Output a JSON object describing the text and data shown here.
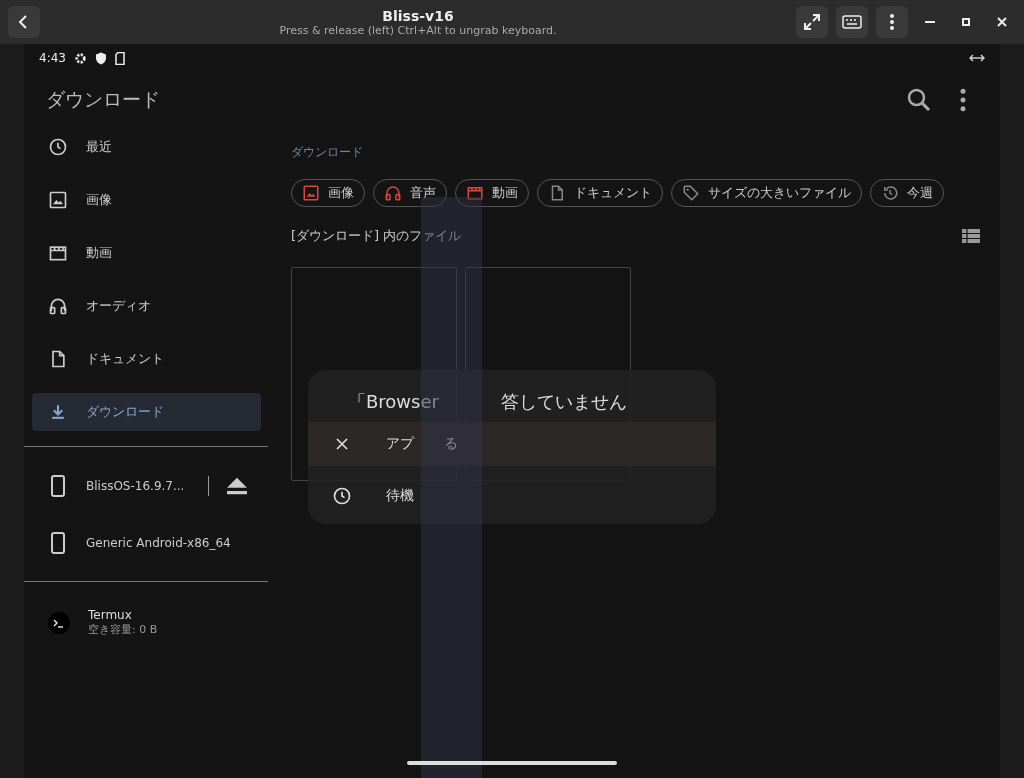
{
  "window": {
    "title": "Bliss-v16",
    "subtitle": "Press & release (left) Ctrl+Alt to ungrab keyboard."
  },
  "status_bar": {
    "time": "4:43"
  },
  "app_bar": {
    "title": "ダウンロード"
  },
  "sidebar": {
    "items": [
      {
        "label": "最近",
        "kind": "recent",
        "selected": false
      },
      {
        "label": "画像",
        "kind": "image",
        "selected": false
      },
      {
        "label": "動画",
        "kind": "video",
        "selected": false
      },
      {
        "label": "オーディオ",
        "kind": "audio",
        "selected": false
      },
      {
        "label": "ドキュメント",
        "kind": "document",
        "selected": false
      },
      {
        "label": "ダウンロード",
        "kind": "download",
        "selected": true
      }
    ],
    "devices": [
      {
        "label": "BlissOS-16.9.7...",
        "eject": true
      },
      {
        "label": "Generic Android-x86_64",
        "eject": false
      }
    ],
    "apps": [
      {
        "label": "Termux",
        "subtitle": "空き容量: 0 B"
      }
    ]
  },
  "breadcrumb": "ダウンロード",
  "chips": [
    {
      "label": "画像",
      "kind": "image"
    },
    {
      "label": "音声",
      "kind": "audio"
    },
    {
      "label": "動画",
      "kind": "video"
    },
    {
      "label": "ドキュメント",
      "kind": "document"
    },
    {
      "label": "サイズの大きいファイル",
      "kind": "tag"
    },
    {
      "label": "今週",
      "kind": "history"
    }
  ],
  "section_label": "[ダウンロード] 内のファイル",
  "dialog": {
    "title_left": "「Browser",
    "title_right": "答していません",
    "options": [
      {
        "kind": "close",
        "label_left": "アプ",
        "label_right": "る",
        "selected": true
      },
      {
        "kind": "wait",
        "label_left": "待機",
        "selected": false
      }
    ]
  }
}
